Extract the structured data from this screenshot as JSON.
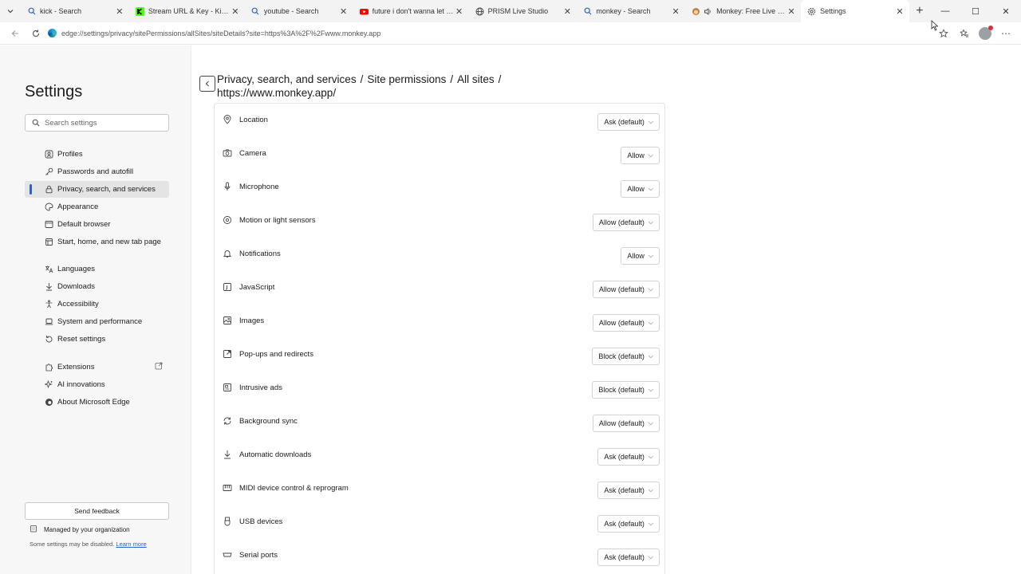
{
  "tabs": [
    {
      "title": "kick - Search",
      "icon": "search-icon"
    },
    {
      "title": "Stream URL & Key - Kick Dashboard",
      "icon": "kick-logo-icon"
    },
    {
      "title": "youtube - Search",
      "icon": "search-icon"
    },
    {
      "title": "future i don't wanna let you go",
      "icon": "youtube-icon"
    },
    {
      "title": "PRISM Live Studio",
      "icon": "globe-icon"
    },
    {
      "title": "monkey - Search",
      "icon": "search-icon"
    },
    {
      "title": "Monkey: Free Live Video Chat",
      "icon": "monkey-icon"
    },
    {
      "title": "Settings",
      "icon": "gear-icon"
    }
  ],
  "address": {
    "url": "edge://settings/privacy/sitePermissions/allSites/siteDetails?site=https%3A%2F%2Fwww.monkey.app"
  },
  "sidebar": {
    "title": "Settings",
    "search_placeholder": "Search settings",
    "items": [
      {
        "label": "Profiles",
        "icon": "profile-icon"
      },
      {
        "label": "Passwords and autofill",
        "icon": "key-icon"
      },
      {
        "label": "Privacy, search, and services",
        "icon": "lock-icon"
      },
      {
        "label": "Appearance",
        "icon": "palette-icon"
      },
      {
        "label": "Default browser",
        "icon": "browser-icon"
      },
      {
        "label": "Start, home, and new tab page",
        "icon": "home-icon"
      },
      {
        "label": "Languages",
        "icon": "languages-icon"
      },
      {
        "label": "Downloads",
        "icon": "download-icon"
      },
      {
        "label": "Accessibility",
        "icon": "accessibility-icon"
      },
      {
        "label": "System and performance",
        "icon": "laptop-icon"
      },
      {
        "label": "Reset settings",
        "icon": "reset-icon"
      },
      {
        "label": "Extensions",
        "icon": "puzzle-icon"
      },
      {
        "label": "AI innovations",
        "icon": "sparkle-icon"
      },
      {
        "label": "About Microsoft Edge",
        "icon": "edge-icon"
      }
    ],
    "feedback_label": "Send feedback",
    "managed_label": "Managed by your organization",
    "disabled_note": "Some settings may be disabled.",
    "learn_more": "Learn more"
  },
  "breadcrumb": {
    "part1": "Privacy, search, and services",
    "part2": "Site permissions",
    "part3": "All sites",
    "part4": "https://www.monkey.app/",
    "separator": "/"
  },
  "permissions": [
    {
      "label": "Location",
      "value": "Ask (default)",
      "icon": "location-icon"
    },
    {
      "label": "Camera",
      "value": "Allow",
      "icon": "camera-icon"
    },
    {
      "label": "Microphone",
      "value": "Allow",
      "icon": "microphone-icon"
    },
    {
      "label": "Motion or light sensors",
      "value": "Allow (default)",
      "icon": "sensor-icon"
    },
    {
      "label": "Notifications",
      "value": "Allow",
      "icon": "bell-icon"
    },
    {
      "label": "JavaScript",
      "value": "Allow (default)",
      "icon": "javascript-icon"
    },
    {
      "label": "Images",
      "value": "Allow (default)",
      "icon": "image-icon"
    },
    {
      "label": "Pop-ups and redirects",
      "value": "Block (default)",
      "icon": "popup-icon"
    },
    {
      "label": "Intrusive ads",
      "value": "Block (default)",
      "icon": "ads-icon"
    },
    {
      "label": "Background sync",
      "value": "Allow (default)",
      "icon": "sync-icon"
    },
    {
      "label": "Automatic downloads",
      "value": "Ask (default)",
      "icon": "download-icon"
    },
    {
      "label": "MIDI device control & reprogram",
      "value": "Ask (default)",
      "icon": "midi-icon"
    },
    {
      "label": "USB devices",
      "value": "Ask (default)",
      "icon": "usb-icon"
    },
    {
      "label": "Serial ports",
      "value": "Ask (default)",
      "icon": "serial-port-icon"
    }
  ],
  "colors": {
    "accent": "#2b62cf",
    "sidebar_bg": "#f7f7f7",
    "selected_bg": "#e4e4e4"
  }
}
